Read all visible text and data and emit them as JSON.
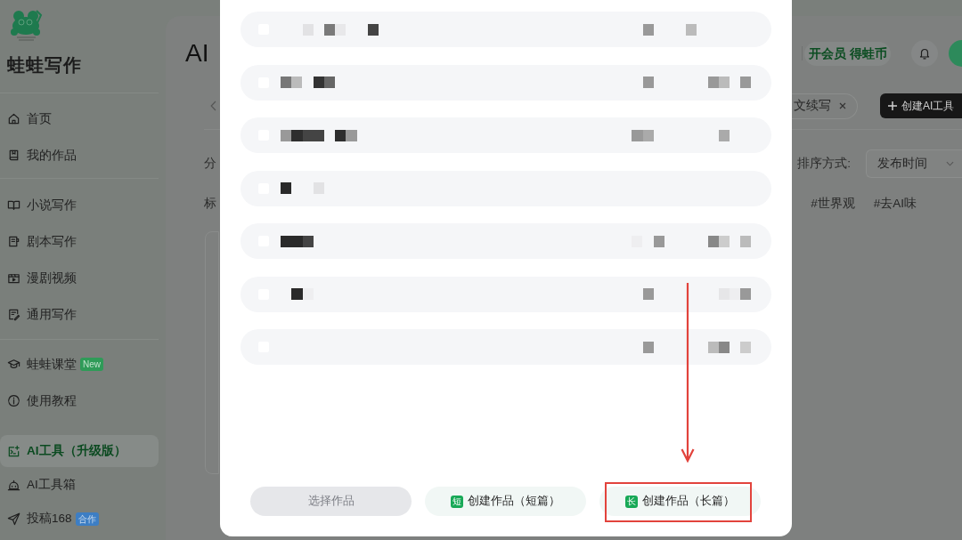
{
  "sidebar": {
    "brand": "蛙蛙写作",
    "sections": [
      {
        "items": [
          {
            "label": "首页",
            "selected": false
          },
          {
            "label": "我的作品",
            "selected": false
          }
        ]
      },
      {
        "items": [
          {
            "label": "小说写作",
            "selected": false
          },
          {
            "label": "剧本写作",
            "selected": false
          },
          {
            "label": "漫剧视频",
            "selected": false
          },
          {
            "label": "通用写作",
            "selected": false
          }
        ]
      },
      {
        "items": [
          {
            "label": "蛙蛙课堂",
            "selected": false,
            "badge": {
              "text": "New",
              "color": "#2f9b58"
            }
          },
          {
            "label": "使用教程",
            "selected": false
          }
        ]
      },
      {
        "items": [
          {
            "label": "AI工具（升级版）",
            "selected": true
          },
          {
            "label": "AI工具箱",
            "selected": false
          },
          {
            "label": "投稿168",
            "selected": false,
            "badge": {
              "text": "合作",
              "color": "#3d7ec4"
            }
          }
        ]
      }
    ]
  },
  "header": {
    "title": "AI",
    "promo": "开会员 得蛙币"
  },
  "toolbar": {
    "chip": "文续写",
    "create_button": "创建AI工具"
  },
  "filters": {
    "category_label": "分",
    "tag_label": "标",
    "sort_label": "排序方式:",
    "sort_value": "发布时间",
    "tags": [
      "#世界观",
      "#去AI味"
    ]
  },
  "dialog": {
    "rows": [
      {
        "checked": false
      },
      {
        "checked": false
      },
      {
        "checked": false
      },
      {
        "checked": false
      },
      {
        "checked": false
      },
      {
        "checked": false
      },
      {
        "checked": false
      }
    ],
    "buttons": [
      {
        "label": "选择作品",
        "disabled": true,
        "highlighted": false
      },
      {
        "label": "创建作品（短篇）",
        "badge": "短",
        "disabled": false,
        "highlighted": false
      },
      {
        "label": "创建作品（长篇）",
        "badge": "长",
        "disabled": false,
        "highlighted": true
      }
    ]
  }
}
